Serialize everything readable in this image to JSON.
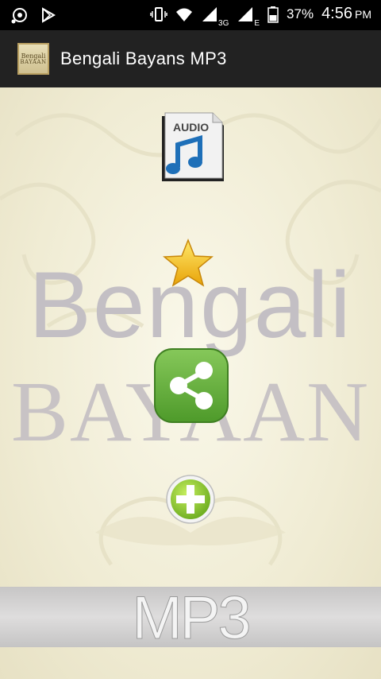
{
  "status_bar": {
    "network_type": "3G",
    "network_type_2": "E",
    "battery_percent": "37%",
    "time": "4:56",
    "time_suffix": "PM"
  },
  "app_bar": {
    "title": "Bengali Bayans MP3",
    "logo_line1": "Bengali",
    "logo_line2": "BAYAAN"
  },
  "main": {
    "audio_label": "AUDIO",
    "watermark_line1": "Bengali",
    "watermark_line2": "BAYAAN",
    "mp3_text": "MP3"
  },
  "icons": {
    "audio": "audio-file-icon",
    "favorite": "star-icon",
    "share": "share-icon",
    "add": "plus-circle-icon"
  },
  "colors": {
    "background": "#f3f0dc",
    "share_green": "#6db33f",
    "star_yellow": "#f6c21a",
    "add_green": "#8cc63e"
  }
}
